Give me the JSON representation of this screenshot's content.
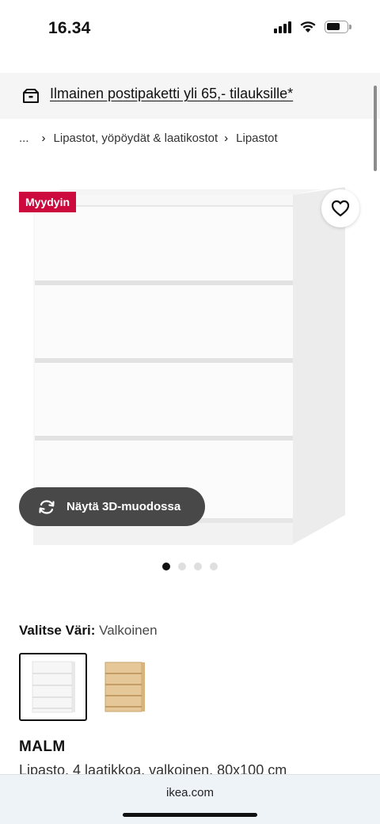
{
  "status": {
    "time": "16.34",
    "battery_level": 0.7
  },
  "promo": {
    "text": "Ilmainen postipaketti yli 65,- tilauksille*",
    "icon": "parcel-icon"
  },
  "breadcrumb": {
    "ellipsis": "...",
    "level1": "Lipastot, yöpöydät & laatikostot",
    "level2": "Lipastot"
  },
  "gallery": {
    "badge": "Myydyin",
    "view3d_label": "Näytä 3D-muodossa",
    "page_count": 4,
    "active_page": 1,
    "favorite_icon": "heart-icon",
    "rotate_icon": "rotate-3d-icon"
  },
  "color": {
    "label": "Valitse Väri:",
    "value": "Valkoinen",
    "options": [
      "white",
      "oak"
    ]
  },
  "product": {
    "name": "MALM",
    "description": "Lipasto, 4 laatikkoa, valkoinen, 80x100 cm"
  },
  "browser": {
    "url": "ikea.com"
  },
  "colors": {
    "badge": "#cc0a3d",
    "button3d": "#484848"
  }
}
